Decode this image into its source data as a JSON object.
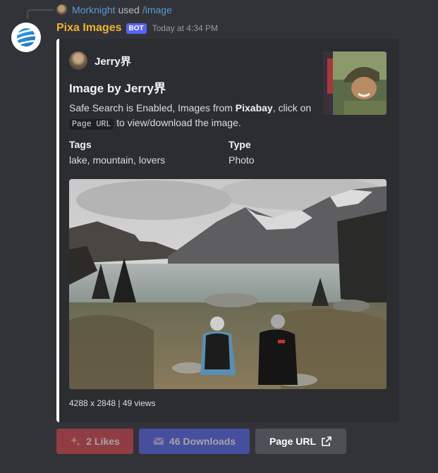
{
  "command": {
    "user": "Morknight",
    "used_text": "used",
    "command": "/image"
  },
  "message": {
    "bot_name": "Pixa Images",
    "bot_tag": "BOT",
    "timestamp": "Today at 4:34 PM",
    "name_color": "#f0b232"
  },
  "embed": {
    "accent_color": "#ffffff",
    "author": "Jerry界",
    "title": "Image by Jerry界",
    "description": {
      "part1": "Safe Search is Enabled, Images from ",
      "source": "Pixabay",
      "part2": ", click on ",
      "code": "Page URL",
      "part3": " to view/download the image."
    },
    "fields": [
      {
        "name": "Tags",
        "value": "lake, mountain, lovers"
      },
      {
        "name": "Type",
        "value": "Photo"
      }
    ],
    "footer": "4288 x 2848 | 49 views"
  },
  "buttons": {
    "likes": {
      "label": "2 Likes",
      "icon": "sparkles-icon"
    },
    "downloads": {
      "label": "46 Downloads",
      "icon": "envelope-icon"
    },
    "page_url": {
      "label": "Page URL",
      "icon": "external-link-icon"
    }
  }
}
